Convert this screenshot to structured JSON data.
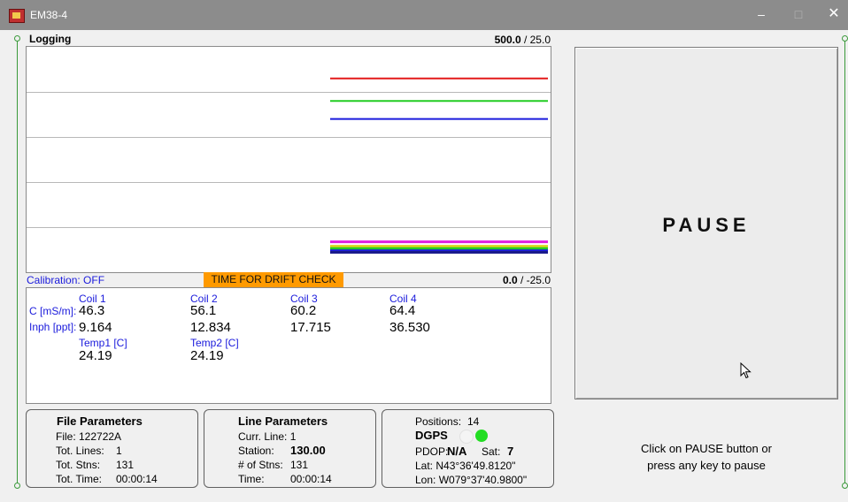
{
  "window": {
    "title": "EM38-4",
    "minimize": "–",
    "maximize": "□",
    "close": "✕"
  },
  "logging": {
    "label": "Logging",
    "range_top_value": "500.0",
    "range_top_sep": "/ 25.0",
    "range_bottom_value": "0.0",
    "range_bottom_sep": "/ -25.0"
  },
  "status": {
    "calibration": "Calibration: OFF",
    "drift_banner": "TIME FOR DRIFT CHECK"
  },
  "readings": {
    "row_labels": {
      "conductivity": "C [mS/m]:",
      "inphase": "Inph [ppt]:"
    },
    "coils": [
      {
        "name": "Coil 1",
        "c": "46.3",
        "inph": "9.164"
      },
      {
        "name": "Coil 2",
        "c": "56.1",
        "inph": "12.834"
      },
      {
        "name": "Coil 3",
        "c": "60.2",
        "inph": "17.715"
      },
      {
        "name": "Coil 4",
        "c": "64.4",
        "inph": "36.530"
      }
    ],
    "temps": [
      {
        "name": "Temp1 [C]",
        "value": "24.19"
      },
      {
        "name": "Temp2 [C]",
        "value": "24.19"
      }
    ]
  },
  "file_params": {
    "title": "File Parameters",
    "file": "File: 122722A",
    "tot_lines_label": "Tot. Lines:",
    "tot_lines": "1",
    "tot_stns_label": "Tot. Stns:",
    "tot_stns": "131",
    "tot_time_label": "Tot. Time:",
    "tot_time": "00:00:14"
  },
  "line_params": {
    "title": "Line Parameters",
    "curr_line": "Curr. Line: 1",
    "station_label": "Station:",
    "station": "130.00",
    "num_stns_label": "# of Stns:",
    "num_stns": "131",
    "time_label": "Time:",
    "time": "00:00:14"
  },
  "gps": {
    "positions_label": "Positions:",
    "positions": "14",
    "dgps": "DGPS",
    "pdop_label": "PDOP:",
    "pdop": "N/A",
    "sat_label": "Sat:",
    "sat": "7",
    "lat": "Lat:  N43°36'49.8120\"",
    "lon": "Lon: W079°37'40.9800\"",
    "indicator_colors": {
      "off": "#f4f4f4",
      "on": "#22dd22"
    }
  },
  "pause": {
    "label": "PAUSE",
    "hint_line1": "Click on PAUSE button or",
    "hint_line2": "press any key to pause"
  },
  "chart_data": {
    "type": "line",
    "grid": "horizontal",
    "ylim_top": [
      25.0,
      500.0
    ],
    "ylim_bottom": [
      -25.0,
      0.0
    ],
    "series": [
      {
        "color": "#e31a1a",
        "level": 0.86
      },
      {
        "color": "#22cc22",
        "level": 0.76
      },
      {
        "color": "#1a1adc",
        "level": 0.68
      },
      {
        "color": "#e020e0",
        "level": 0.135
      },
      {
        "color": "#d8d820",
        "level": 0.115
      },
      {
        "color": "#22cc22",
        "level": 0.105
      },
      {
        "color": "#1a1adc",
        "level": 0.095
      },
      {
        "color": "#1a1a8a",
        "level": 0.088
      }
    ],
    "x_start": 0.58,
    "x_end": 0.995
  }
}
